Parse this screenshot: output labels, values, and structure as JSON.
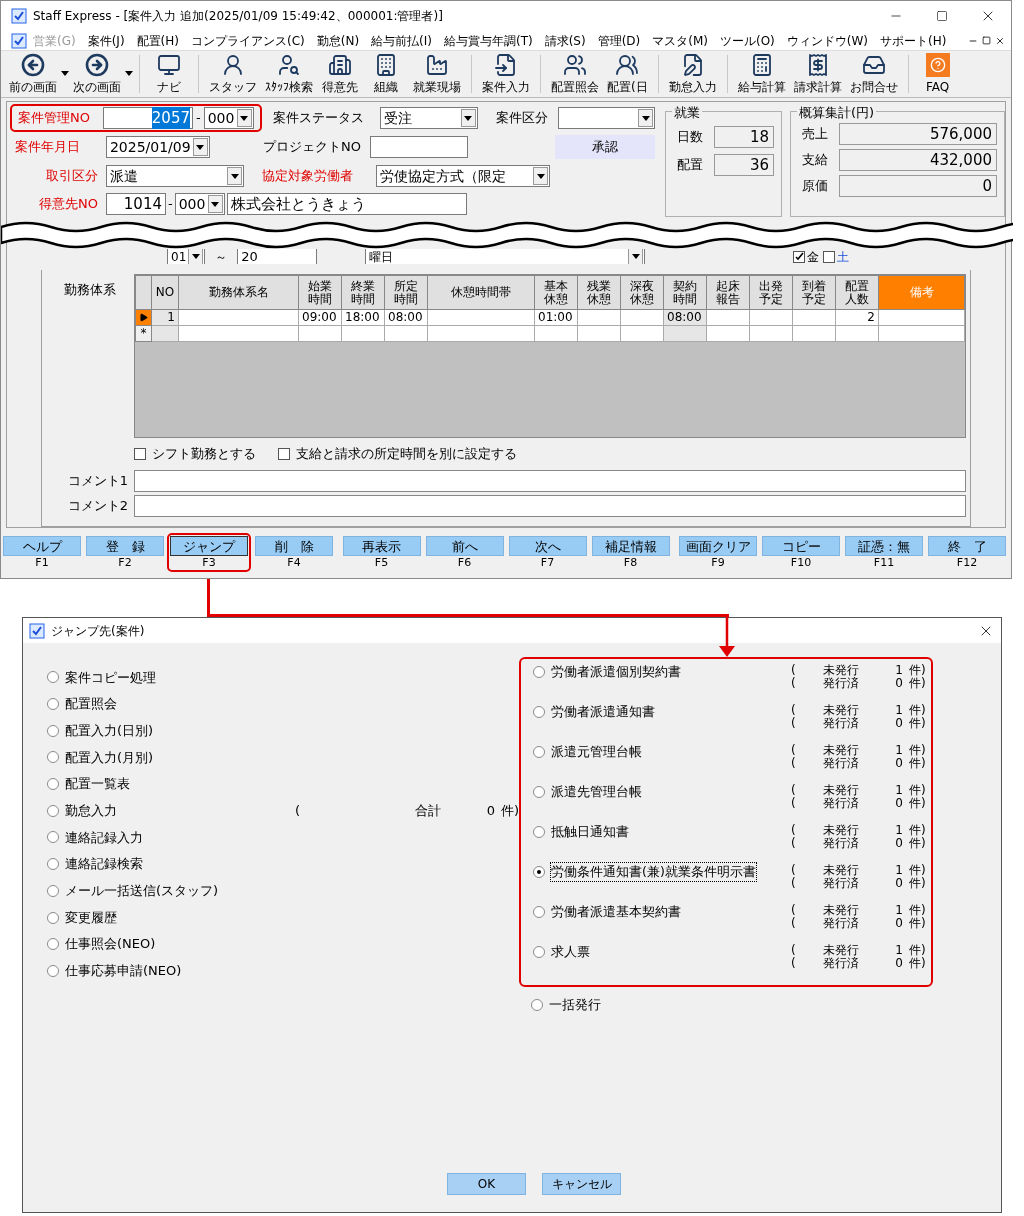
{
  "window": {
    "title": "Staff Express - [案件入力  追加(2025/01/09 15:49:42、000001:管理者)]"
  },
  "menu": [
    {
      "label": "営業(G)",
      "disabled": true
    },
    {
      "label": "案件(J)",
      "disabled": false
    },
    {
      "label": "配置(H)",
      "disabled": false
    },
    {
      "label": "コンプライアンス(C)",
      "disabled": false
    },
    {
      "label": "勤怠(N)",
      "disabled": false
    },
    {
      "label": "給与前払(I)",
      "disabled": false
    },
    {
      "label": "給与賞与年調(T)",
      "disabled": false
    },
    {
      "label": "請求(S)",
      "disabled": false
    },
    {
      "label": "管理(D)",
      "disabled": false
    },
    {
      "label": "マスタ(M)",
      "disabled": false
    },
    {
      "label": "ツール(O)",
      "disabled": false
    },
    {
      "label": "ウィンドウ(W)",
      "disabled": false
    },
    {
      "label": "サポート(H)",
      "disabled": false
    }
  ],
  "toolbar": [
    {
      "label": "前の画面",
      "dropdown": true
    },
    {
      "label": "次の画面",
      "dropdown": true
    },
    {
      "label": "ナビ",
      "dropdown": false
    },
    {
      "label": "スタッフ",
      "dropdown": false
    },
    {
      "label": "ｽﾀｯﾌ検索",
      "dropdown": false
    },
    {
      "label": "得意先",
      "dropdown": false
    },
    {
      "label": "組織",
      "dropdown": false
    },
    {
      "label": "就業現場",
      "dropdown": false
    },
    {
      "label": "案件入力",
      "dropdown": false
    },
    {
      "label": "配置照会",
      "dropdown": false
    },
    {
      "label": "配置(日",
      "dropdown": false
    },
    {
      "label": "勤怠入力",
      "dropdown": false
    },
    {
      "label": "給与計算",
      "dropdown": false
    },
    {
      "label": "請求計算",
      "dropdown": false
    },
    {
      "label": "お問合せ",
      "dropdown": false
    },
    {
      "label": "FAQ",
      "dropdown": false
    }
  ],
  "case_form": {
    "case_no": {
      "label": "案件管理NO",
      "required": true,
      "number": "2057",
      "number_selected": true,
      "sep": "-",
      "branch": "000"
    },
    "status": {
      "label": "案件ステータス",
      "required": false,
      "value": "受注"
    },
    "category": {
      "label": "案件区分",
      "required": false
    },
    "date": {
      "label": "案件年月日",
      "required": true,
      "value": "2025/01/09"
    },
    "project_no": {
      "label": "プロジェクトNO",
      "required": false
    },
    "approve_button": "承認",
    "deal_type": {
      "label": "取引区分",
      "required": true,
      "value": "派遣"
    },
    "agreement": {
      "label": "協定対象労働者",
      "required": true,
      "value": "労使協定方式（限定"
    },
    "client": {
      "label": "得意先NO",
      "required": true,
      "number": "1014",
      "sep": "-",
      "branch": "000",
      "name": "株式会社とうきょう"
    }
  },
  "period_row": {
    "start": "01",
    "tilde": "～",
    "end": "20",
    "weekday": "曜日",
    "days": [
      {
        "label": "金",
        "checked": true
      },
      {
        "label": "土",
        "checked": false
      }
    ]
  },
  "work_summary": {
    "title": "就業",
    "items": [
      {
        "label": "日数",
        "value": "18"
      },
      {
        "label": "配置",
        "value": "36"
      }
    ]
  },
  "estimate": {
    "title": "概算集計(円)",
    "items": [
      {
        "label": "売上",
        "value": "576,000"
      },
      {
        "label": "支給",
        "value": "432,000"
      },
      {
        "label": "原価",
        "value": "0"
      }
    ]
  },
  "shifts": {
    "label": "勤務体系",
    "columns": [
      {
        "label": "NO",
        "highlight": false
      },
      {
        "label": "勤務体系名",
        "highlight": false
      },
      {
        "label": "始業時間",
        "highlight": false
      },
      {
        "label": "終業時間",
        "highlight": false
      },
      {
        "label": "所定時間",
        "highlight": false
      },
      {
        "label": "休憩時間帯",
        "highlight": false
      },
      {
        "label": "基本休憩",
        "highlight": false
      },
      {
        "label": "残業休憩",
        "highlight": false
      },
      {
        "label": "深夜休憩",
        "highlight": false
      },
      {
        "label": "契約時間",
        "highlight": false
      },
      {
        "label": "起床報告",
        "highlight": false
      },
      {
        "label": "出発予定",
        "highlight": false
      },
      {
        "label": "到着予定",
        "highlight": false
      },
      {
        "label": "配置人数",
        "highlight": false
      },
      {
        "label": "備考",
        "highlight": true
      }
    ],
    "rows": [
      {
        "kind": "current",
        "cells": [
          "1",
          null,
          "09:00",
          "18:00",
          "08:00",
          null,
          "01:00",
          null,
          null,
          "08:00",
          null,
          null,
          null,
          "2",
          null
        ]
      },
      {
        "kind": "new",
        "marker": "*"
      }
    ]
  },
  "options": [
    {
      "label": "シフト勤務とする",
      "checked": false
    },
    {
      "label": "支給と請求の所定時間を別に設定する",
      "checked": false
    }
  ],
  "comments": [
    {
      "label": "コメント1"
    },
    {
      "label": "コメント2"
    }
  ],
  "function_keys": [
    {
      "label": "ヘルプ",
      "key": "F1",
      "focused": false
    },
    {
      "label": "登　録",
      "key": "F2",
      "focused": false
    },
    {
      "label": "ジャンプ",
      "key": "F3",
      "focused": true
    },
    {
      "label": "削　除",
      "key": "F4",
      "focused": false
    },
    {
      "label": "再表示",
      "key": "F5",
      "focused": false
    },
    {
      "label": "前へ",
      "key": "F6",
      "focused": false
    },
    {
      "label": "次へ",
      "key": "F7",
      "focused": false
    },
    {
      "label": "補足情報",
      "key": "F8",
      "focused": false
    },
    {
      "label": "画面クリア",
      "key": "F9",
      "focused": false
    },
    {
      "label": "コピー",
      "key": "F10",
      "focused": false
    },
    {
      "label": "証憑：無",
      "key": "F11",
      "focused": false
    },
    {
      "label": "終　了",
      "key": "F12",
      "focused": false
    }
  ],
  "dialog": {
    "title": "ジャンプ先(案件)",
    "options": [
      {
        "label": "案件コピー処理",
        "selected": false
      },
      {
        "label": "配置照会",
        "selected": false
      },
      {
        "label": "配置入力(日別)",
        "selected": false
      },
      {
        "label": "配置入力(月別)",
        "selected": false
      },
      {
        "label": "配置一覧表",
        "selected": false
      },
      {
        "label": "勤怠入力",
        "selected": false,
        "note": {
          "paren": "(",
          "label": "合計",
          "count": "0",
          "unit": "件)"
        }
      },
      {
        "label": "連絡記録入力",
        "selected": false
      },
      {
        "label": "連絡記録検索",
        "selected": false
      },
      {
        "label": "メール一括送信(スタッフ)",
        "selected": false
      },
      {
        "label": "変更履歴",
        "selected": false
      },
      {
        "label": "仕事照会(NEO)",
        "selected": false
      },
      {
        "label": "仕事応募申請(NEO)",
        "selected": false
      }
    ],
    "documents": [
      {
        "label": "労働者派遣個別契約書",
        "selected": false,
        "status": [
          {
            "paren": "(",
            "label": "未発行",
            "count": "1",
            "unit": "件)"
          },
          {
            "paren": "(",
            "label": "発行済",
            "count": "0",
            "unit": "件)"
          }
        ]
      },
      {
        "label": "労働者派遣通知書",
        "selected": false,
        "status": [
          {
            "paren": "(",
            "label": "未発行",
            "count": "1",
            "unit": "件)"
          },
          {
            "paren": "(",
            "label": "発行済",
            "count": "0",
            "unit": "件)"
          }
        ]
      },
      {
        "label": "派遣元管理台帳",
        "selected": false,
        "status": [
          {
            "paren": "(",
            "label": "未発行",
            "count": "1",
            "unit": "件)"
          },
          {
            "paren": "(",
            "label": "発行済",
            "count": "0",
            "unit": "件)"
          }
        ]
      },
      {
        "label": "派遣先管理台帳",
        "selected": false,
        "status": [
          {
            "paren": "(",
            "label": "未発行",
            "count": "1",
            "unit": "件)"
          },
          {
            "paren": "(",
            "label": "発行済",
            "count": "0",
            "unit": "件)"
          }
        ]
      },
      {
        "label": "抵触日通知書",
        "selected": false,
        "status": [
          {
            "paren": "(",
            "label": "未発行",
            "count": "1",
            "unit": "件)"
          },
          {
            "paren": "(",
            "label": "発行済",
            "count": "0",
            "unit": "件)"
          }
        ]
      },
      {
        "label": "労働条件通知書(兼)就業条件明示書",
        "selected": true,
        "status": [
          {
            "paren": "(",
            "label": "未発行",
            "count": "1",
            "unit": "件)"
          },
          {
            "paren": "(",
            "label": "発行済",
            "count": "0",
            "unit": "件)"
          }
        ]
      },
      {
        "label": "労働者派遣基本契約書",
        "selected": false,
        "status": [
          {
            "paren": "(",
            "label": "未発行",
            "count": "1",
            "unit": "件)"
          },
          {
            "paren": "(",
            "label": "発行済",
            "count": "0",
            "unit": "件)"
          }
        ]
      },
      {
        "label": "求人票",
        "selected": false,
        "status": [
          {
            "paren": "(",
            "label": "未発行",
            "count": "1",
            "unit": "件)"
          },
          {
            "paren": "(",
            "label": "発行済",
            "count": "0",
            "unit": "件)"
          }
        ]
      }
    ],
    "bulk": {
      "label": "一括発行",
      "selected": false
    },
    "buttons": [
      "OK",
      "キャンセル"
    ]
  }
}
